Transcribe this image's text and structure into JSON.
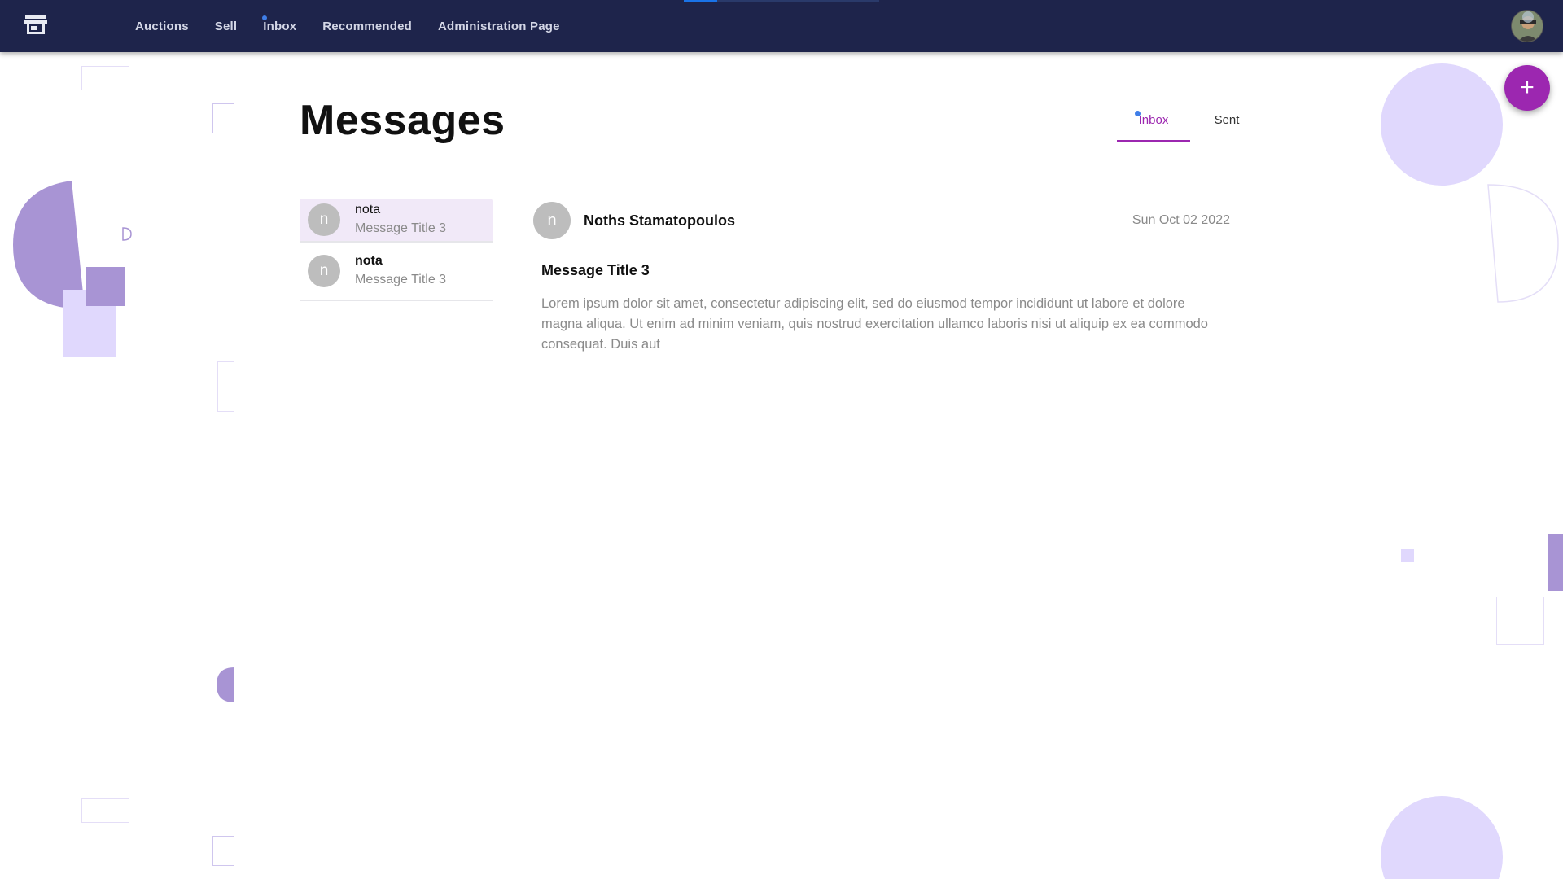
{
  "topbar": {
    "nav": [
      "Auctions",
      "Sell",
      "Inbox",
      "Recommended",
      "Administration Page"
    ],
    "loading_progress_percent": 17
  },
  "page": {
    "title": "Messages",
    "tabs": [
      {
        "label": "Inbox",
        "active": true,
        "unread_dot": true
      },
      {
        "label": "Sent",
        "active": false
      }
    ]
  },
  "messages": [
    {
      "avatar_letter": "n",
      "sender": "nota",
      "subject": "Message Title 3",
      "selected": true,
      "unread": false
    },
    {
      "avatar_letter": "n",
      "sender": "nota",
      "subject": "Message Title 3",
      "selected": false,
      "unread": true
    }
  ],
  "detail": {
    "avatar_letter": "n",
    "sender": "Noths Stamatopoulos",
    "date": "Sun Oct 02 2022",
    "title": "Message Title 3",
    "body": "Lorem ipsum dolor sit amet, consectetur adipiscing elit, sed do eiusmod tempor incididunt ut labore et dolore magna aliqua. Ut enim ad minim veniam, quis nostrud exercitation ullamco laboris nisi ut aliquip ex ea commodo consequat. Duis aut"
  },
  "fab": {
    "symbol": "+"
  },
  "colors": {
    "topbar": "#1e244b",
    "accent": "#9c27b0",
    "notification_dot": "#3f7ee8",
    "deco_purple": "#a894d4",
    "deco_lilac": "#e0d8fd"
  },
  "icons": {
    "logo": "storefront-icon",
    "fab": "plus-icon",
    "user": "user-avatar"
  }
}
